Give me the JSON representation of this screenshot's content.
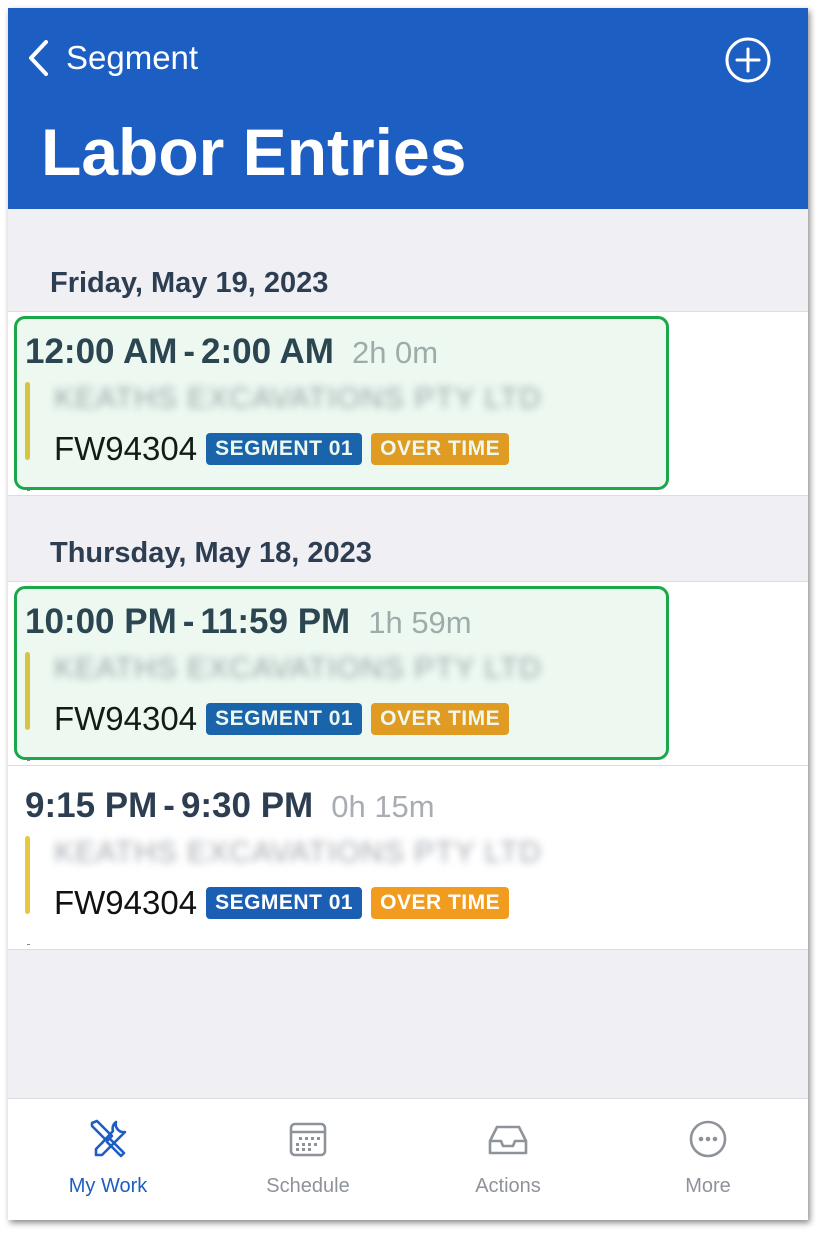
{
  "nav": {
    "back_label": "Segment",
    "title": "Labor Entries",
    "back_icon": "chevron-left-icon",
    "add_icon": "plus-circle-icon"
  },
  "sections": [
    {
      "date": "Friday, May 19, 2023",
      "entries": [
        {
          "start": "12:00 AM",
          "separator": "-",
          "end": "2:00 AM",
          "duration": "2h 0m",
          "company": "KEATHS EXCAVATIONS PTY LTD",
          "work_order": "FW94304",
          "segment_badge": "SEGMENT 01",
          "type_badge": "OVER TIME",
          "highlighted": true
        }
      ]
    },
    {
      "date": "Thursday, May 18, 2023",
      "entries": [
        {
          "start": "10:00 PM",
          "separator": "-",
          "end": "11:59 PM",
          "duration": "1h 59m",
          "company": "KEATHS EXCAVATIONS PTY LTD",
          "work_order": "FW94304",
          "segment_badge": "SEGMENT 01",
          "type_badge": "OVER TIME",
          "highlighted": true
        },
        {
          "start": "9:15 PM",
          "separator": "-",
          "end": "9:30 PM",
          "duration": "0h 15m",
          "company": "KEATHS EXCAVATIONS PTY LTD",
          "work_order": "FW94304",
          "segment_badge": "SEGMENT 01",
          "type_badge": "OVER TIME",
          "highlighted": false
        }
      ]
    }
  ],
  "tabbar": {
    "items": [
      {
        "label": "My Work",
        "icon": "tools-icon",
        "active": true
      },
      {
        "label": "Schedule",
        "icon": "calendar-icon",
        "active": false
      },
      {
        "label": "Actions",
        "icon": "inbox-icon",
        "active": false
      },
      {
        "label": "More",
        "icon": "more-circle-icon",
        "active": false
      }
    ]
  },
  "colors": {
    "nav_background": "#1d5ec3",
    "highlight_border": "#1ba84a",
    "segment_badge": "#1a5fb4",
    "overtime_badge": "#f19b1f",
    "accent_bar": "#e8c840"
  }
}
